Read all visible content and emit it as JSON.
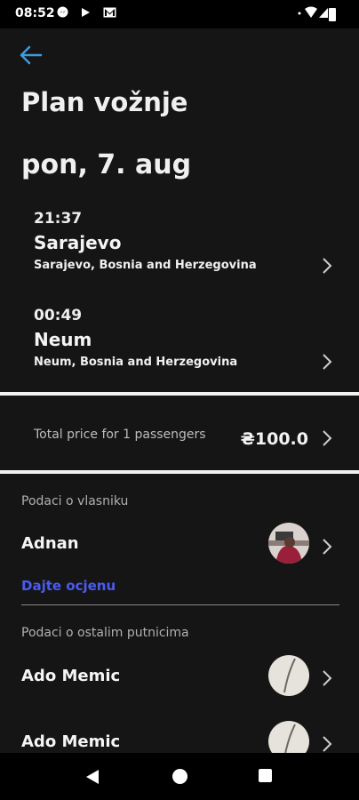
{
  "status_bar": {
    "time": "08:52",
    "left_icons": [
      "messenger-icon",
      "play-store-icon",
      "gmail-icon"
    ],
    "right_icons": [
      "signal-icon",
      "wifi-icon",
      "battery-icon"
    ]
  },
  "header": {
    "title": "Plan vožnje",
    "date": "pon, 7. aug"
  },
  "route": [
    {
      "time": "21:37",
      "city": "Sarajevo",
      "address": "Sarajevo, Bosnia and Herzegovina"
    },
    {
      "time": "00:49",
      "city": "Neum",
      "address": "Neum, Bosnia and Herzegovina"
    }
  ],
  "price": {
    "label": "Total price for 1 passengers",
    "value": "₴100.0"
  },
  "owner": {
    "section_label": "Podaci o vlasniku",
    "name": "Adnan",
    "rate_label": "Dajte ocjenu"
  },
  "passengers": {
    "section_label": "Podaci o ostalim putnicima",
    "items": [
      {
        "name": "Ado Memic"
      },
      {
        "name": "Ado Memic"
      }
    ]
  },
  "colors": {
    "background": "#151515",
    "accent_back": "#3f9ad8",
    "link": "#4a5bf0"
  }
}
